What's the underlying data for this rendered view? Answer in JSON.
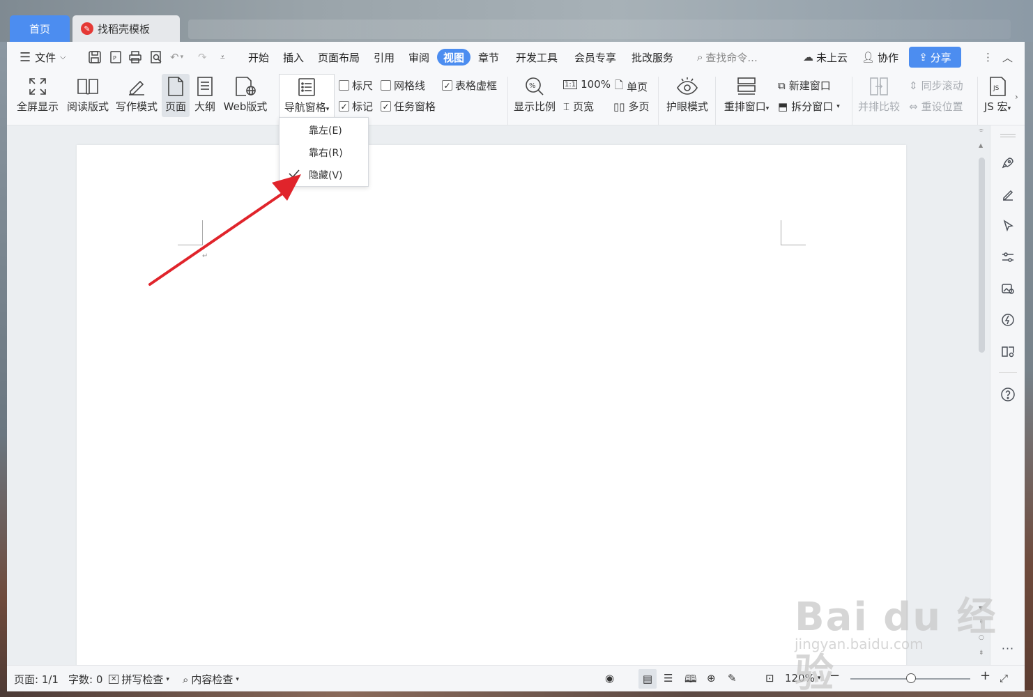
{
  "tabs": {
    "home": "首页",
    "template": "找稻壳模板"
  },
  "menu": {
    "file": "文件",
    "items": [
      "开始",
      "插入",
      "页面布局",
      "引用",
      "审阅",
      "视图",
      "章节",
      "开发工具",
      "会员专享",
      "批改服务"
    ],
    "active": "视图",
    "search": "查找命令...",
    "cloud": "未上云",
    "collab": "协作",
    "share": "分享"
  },
  "ribbon": {
    "fullscreen": "全屏显示",
    "reading": "阅读版式",
    "writing": "写作模式",
    "page": "页面",
    "outline": "大纲",
    "web": "Web版式",
    "nav_pane": "导航窗格",
    "ruler": "标尺",
    "gridlines": "网格线",
    "table_gridlines": "表格虚框",
    "marks": "标记",
    "task_pane": "任务窗格",
    "zoom": "显示比例",
    "zoom100": "100%",
    "page_width": "页宽",
    "single_page": "单页",
    "multi_page": "多页",
    "eye_mode": "护眼模式",
    "rearrange": "重排窗口",
    "new_window": "新建窗口",
    "split_window": "拆分窗口",
    "side_by_side": "并排比较",
    "sync_scroll": "同步滚动",
    "reset_pos": "重设位置",
    "js_macro": "JS 宏"
  },
  "checks": {
    "ruler": false,
    "gridlines": false,
    "table_gridlines": true,
    "marks": true,
    "task_pane": true
  },
  "nav_dropdown": {
    "items": [
      "靠左(E)",
      "靠右(R)",
      "隐藏(V)"
    ],
    "checked": "隐藏(V)"
  },
  "status": {
    "page": "页面: 1/1",
    "words": "字数: 0",
    "spell": "拼写检查",
    "content": "内容检查",
    "zoom": "120%"
  },
  "watermark": {
    "main": "Bai du 经验",
    "sub": "jingyan.baidu.com"
  },
  "colors": {
    "accent": "#4c8df0",
    "arrow": "#e0242b"
  }
}
